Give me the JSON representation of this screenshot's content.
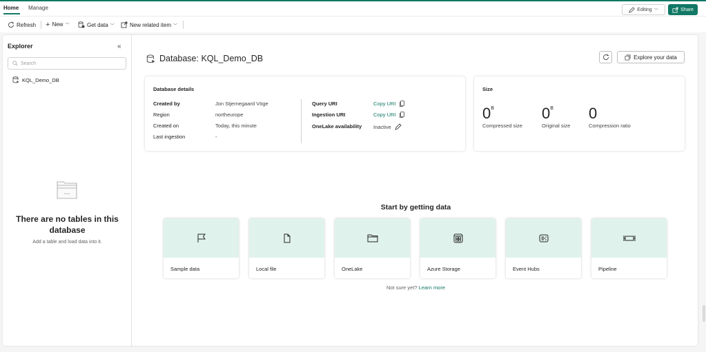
{
  "tabs": {
    "home": "Home",
    "manage": "Manage"
  },
  "top_actions": {
    "editing": "Editing",
    "share": "Share"
  },
  "toolbar": {
    "refresh": "Refresh",
    "new": "New",
    "get_data": "Get data",
    "new_related": "New related item"
  },
  "explorer": {
    "title": "Explorer",
    "search_placeholder": "Search",
    "items": [
      {
        "label": "KQL_Demo_DB"
      }
    ],
    "empty_title": "There are no tables in this database",
    "empty_subtitle": "Add a table and load data into it."
  },
  "header": {
    "title": "Database: KQL_Demo_DB",
    "explore_button": "Explore your data"
  },
  "details": {
    "heading": "Database details",
    "left": [
      {
        "label": "Created by",
        "value": "Jon Stjernegaard Vöge"
      },
      {
        "label": "Region",
        "value": "northeurope"
      },
      {
        "label": "Created on",
        "value": "Today, this minute"
      },
      {
        "label": "Last ingestion",
        "value": "-"
      }
    ],
    "right": [
      {
        "label": "Query URI",
        "value": "Copy URI"
      },
      {
        "label": "Ingestion URI",
        "value": "Copy URI"
      },
      {
        "label": "OneLake availability",
        "value": "Inactive"
      }
    ]
  },
  "size": {
    "heading": "Size",
    "metrics": [
      {
        "value": "0",
        "unit": "B",
        "label": "Compressed size"
      },
      {
        "value": "0",
        "unit": "B",
        "label": "Original size"
      },
      {
        "value": "0",
        "unit": "",
        "label": "Compression ratio"
      }
    ]
  },
  "get_data": {
    "title": "Start by getting data",
    "tiles": [
      {
        "label": "Sample data",
        "icon": "flag-icon"
      },
      {
        "label": "Local file",
        "icon": "file-icon"
      },
      {
        "label": "OneLake",
        "icon": "folder-icon"
      },
      {
        "label": "Azure Storage",
        "icon": "storage-icon"
      },
      {
        "label": "Event Hubs",
        "icon": "event-hubs-icon"
      },
      {
        "label": "Pipeline",
        "icon": "pipeline-icon"
      }
    ],
    "not_sure": "Not sure yet?",
    "learn_more": "Learn more"
  },
  "colors": {
    "accent": "#117865",
    "tile_bg": "#e0f2ec"
  }
}
